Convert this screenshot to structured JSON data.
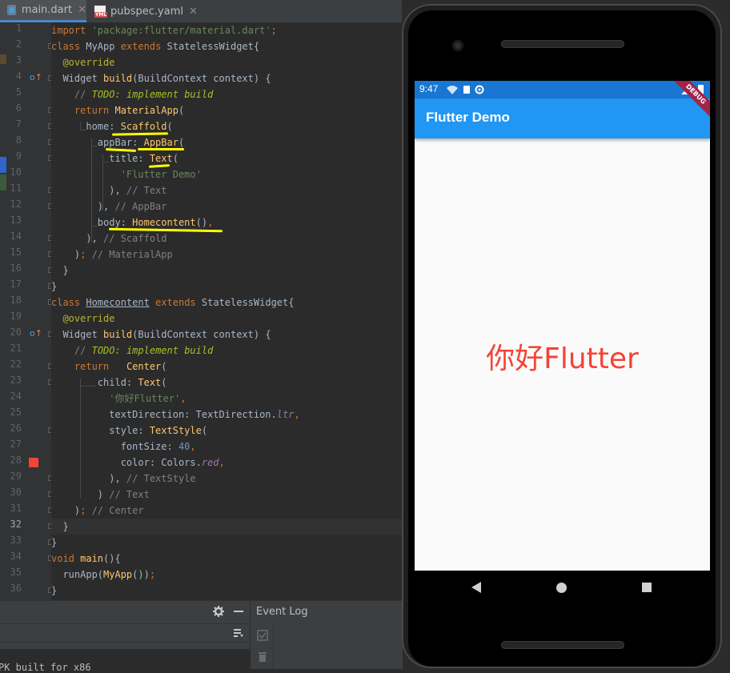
{
  "tabs": [
    {
      "label": "main.dart",
      "icon": "dart-file-icon",
      "active": true
    },
    {
      "label": "pubspec.yaml",
      "icon": "yaml-file-icon",
      "active": false
    }
  ],
  "editor": {
    "current_line": 32,
    "line_numbers": [
      "1",
      "2",
      "3",
      "4",
      "5",
      "6",
      "7",
      "8",
      "9",
      "10",
      "11",
      "12",
      "13",
      "14",
      "15",
      "16",
      "17",
      "18",
      "19",
      "20",
      "21",
      "22",
      "23",
      "24",
      "25",
      "26",
      "27",
      "28",
      "29",
      "30",
      "31",
      "32",
      "33",
      "34",
      "35",
      "36"
    ],
    "colors": {
      "background": "#2b2b2b",
      "keyword": "#cc7832",
      "string": "#6a8759",
      "function": "#ffc66d",
      "annotation_highlight": "#ffff00",
      "color_swatch": "#f44336"
    }
  },
  "bottom_panel": {
    "event_log_label": "Event Log",
    "console_snippet": "PK built for x86"
  },
  "emulator": {
    "status_time": "9:47",
    "debug_banner": "DEBUG",
    "appbar_title": "Flutter Demo",
    "body_text": "你好Flutter",
    "colors": {
      "appbar": "#2196f3",
      "statusbar": "#1976d2",
      "body_text": "#f44336",
      "body_bg": "#fafafa"
    }
  }
}
